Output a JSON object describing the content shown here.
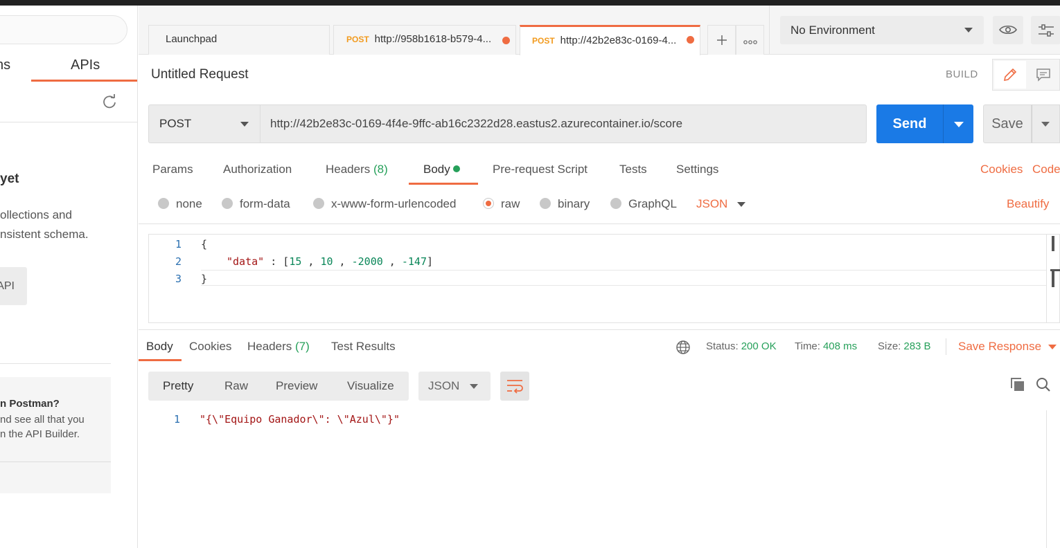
{
  "sidebar": {
    "tabs": {
      "collections": "ns",
      "apis": "APIs"
    },
    "heading": "yet",
    "description": [
      "ollections and",
      "nsistent schema."
    ],
    "api_button": "API",
    "card": {
      "title": "n Postman?",
      "text": [
        "nd see all that you",
        "n the API Builder."
      ]
    }
  },
  "tabs": [
    {
      "label": "Launchpad"
    },
    {
      "method": "POST",
      "label": "http://958b1618-b579-4..."
    },
    {
      "method": "POST",
      "label": "http://42b2e83c-0169-4..."
    }
  ],
  "environment": {
    "selected": "No Environment"
  },
  "request": {
    "title": "Untitled Request",
    "mode": "BUILD",
    "method": "POST",
    "url": "http://42b2e83c-0169-4f4e-9ffc-ab16c2322d28.eastus2.azurecontainer.io/score",
    "send_label": "Send",
    "save_label": "Save",
    "subtabs": {
      "params": "Params",
      "authorization": "Authorization",
      "headers": "Headers",
      "headers_count": "(8)",
      "body": "Body",
      "prerequest": "Pre-request Script",
      "tests": "Tests",
      "settings": "Settings"
    },
    "links": {
      "cookies": "Cookies",
      "code": "Code",
      "beautify": "Beautify"
    },
    "body_types": {
      "none": "none",
      "form_data": "form-data",
      "urlencoded": "x-www-form-urlencoded",
      "raw": "raw",
      "binary": "binary",
      "graphql": "GraphQL",
      "selected": "raw"
    },
    "body_language": "JSON",
    "body_lines": {
      "n1": "1",
      "n2": "2",
      "n3": "3",
      "l1": "{",
      "key": "\"data\"",
      "colon": " : [",
      "v1": "15",
      "sep1": " , ",
      "v2": "10",
      "sep2": " , ",
      "v3": "-2000",
      "sep3": " , ",
      "v4": "-147",
      "close": "]",
      "l3": "}"
    }
  },
  "response": {
    "tabs": {
      "body": "Body",
      "cookies": "Cookies",
      "headers": "Headers",
      "headers_count": "(7)",
      "test_results": "Test Results"
    },
    "status_label": "Status:",
    "status_value": "200 OK",
    "time_label": "Time:",
    "time_value": "408 ms",
    "size_label": "Size:",
    "size_value": "283 B",
    "save_response": "Save Response",
    "views": {
      "pretty": "Pretty",
      "raw": "Raw",
      "preview": "Preview",
      "visualize": "Visualize"
    },
    "language": "JSON",
    "body_line_number": "1",
    "body_line": "\"{\\\"Equipo Ganador\\\": \\\"Azul\\\"}\""
  },
  "colors": {
    "accent": "#ef6c42",
    "primary": "#1a7ae6",
    "success": "#26a05a",
    "post_method": "#f29b1f"
  }
}
